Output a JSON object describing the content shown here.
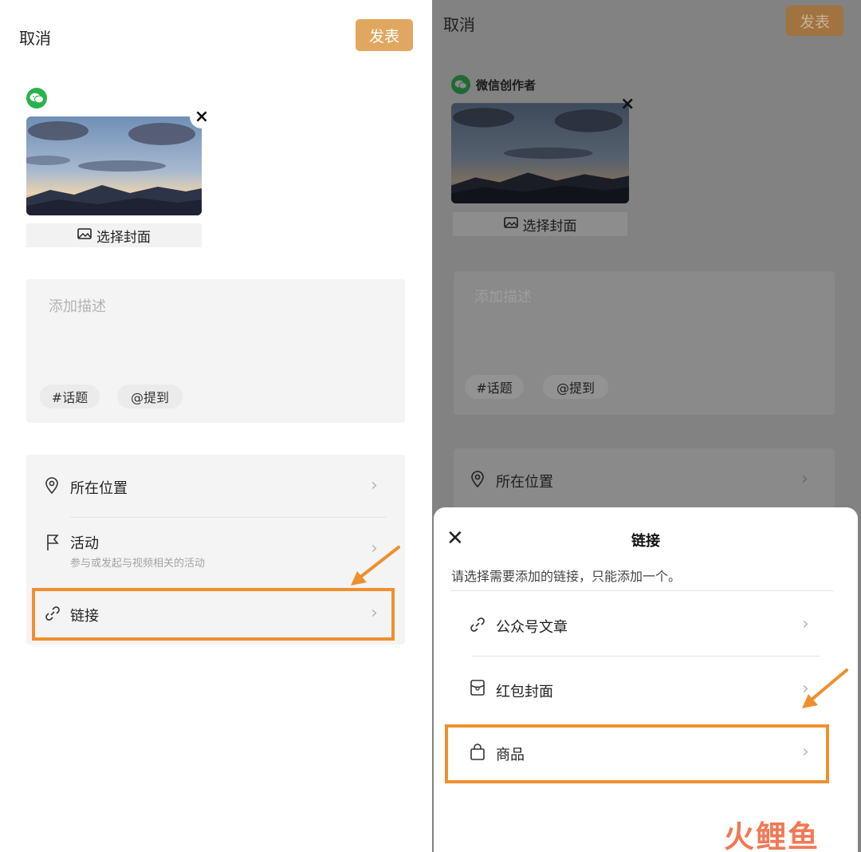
{
  "left": {
    "cancel_label": "取消",
    "publish_label": "发表",
    "choose_cover_label": "选择封面",
    "description_placeholder": "添加描述",
    "chips": [
      "#话题",
      "@提到"
    ],
    "options": [
      {
        "label": "所在位置",
        "sublabel": ""
      },
      {
        "label": "活动",
        "sublabel": "参与或发起与视频相关的活动"
      },
      {
        "label": "链接",
        "sublabel": ""
      }
    ]
  },
  "right": {
    "cancel_label": "取消",
    "publish_label": "发表",
    "account_name": "微信创作者",
    "choose_cover_label": "选择封面",
    "description_placeholder": "添加描述",
    "chips": [
      "#话题",
      "@提到"
    ],
    "location_label": "所在位置",
    "sheet": {
      "title": "链接",
      "hint": "请选择需要添加的链接，只能添加一个。",
      "items": [
        {
          "label": "公众号文章",
          "icon": "link-icon"
        },
        {
          "label": "红包封面",
          "icon": "red-packet-icon"
        },
        {
          "label": "商品",
          "icon": "shopping-bag-icon"
        }
      ]
    }
  },
  "watermark": "火鲤鱼",
  "colors": {
    "publish": "#e0a760",
    "highlight": "#ef8f2f",
    "wechat_green": "#2ab24c",
    "overlay": "#828282"
  }
}
